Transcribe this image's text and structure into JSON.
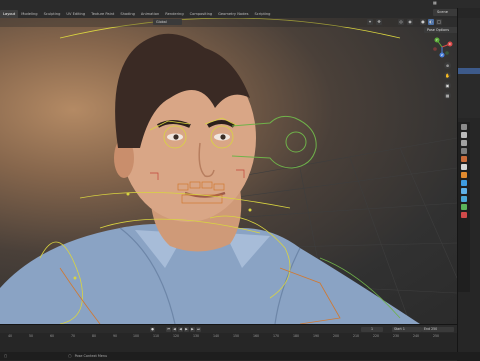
{
  "topbar": {
    "tabs": [
      "Layout",
      "Modeling",
      "Sculpting",
      "UV Editing",
      "Texture Paint",
      "Shading",
      "Animation",
      "Rendering",
      "Compositing",
      "Geometry Nodes",
      "Scripting"
    ],
    "active_tab": "Layout",
    "scene_label": "Scene"
  },
  "viewport": {
    "mode": "Global",
    "pose_options": "Pose Options",
    "header_icons": [
      "cursor-icon",
      "move-icon",
      "gizmo-icon",
      "overlay-icon",
      "shading-solid-icon",
      "shading-material-icon",
      "shading-rendered-icon"
    ],
    "gizmo_axes": [
      "X",
      "Y",
      "Z"
    ]
  },
  "timeline": {
    "ticks": [
      "40",
      "50",
      "60",
      "70",
      "80",
      "90",
      "100",
      "110",
      "120",
      "130",
      "140",
      "150",
      "160",
      "170",
      "180",
      "190",
      "200",
      "210",
      "220",
      "230",
      "240",
      "250"
    ],
    "current_frame": "1",
    "start_label": "Start",
    "start_value": "1",
    "end_label": "End",
    "end_value": "250"
  },
  "status": {
    "left_text": "Pose Context Menu"
  },
  "colors": {
    "accent_blue": "#3d5a8a",
    "bone_yellow": "#d9d440",
    "bone_green": "#6fb24a",
    "bone_orange": "#d1782f",
    "bone_red": "#c2443a"
  }
}
